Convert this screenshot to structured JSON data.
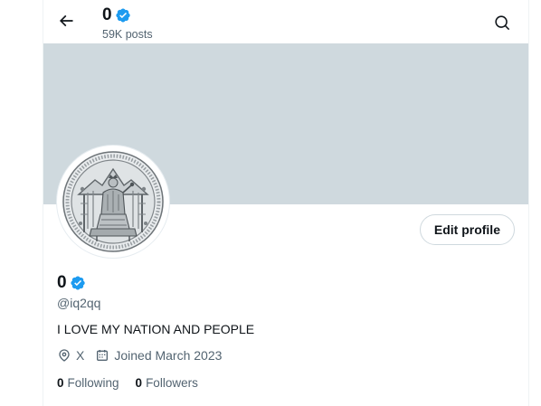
{
  "header": {
    "name": "0",
    "posts_count": "59K posts"
  },
  "profile": {
    "name": "0",
    "handle": "@iq2qq",
    "bio": "I LOVE MY NATION AND PEOPLE",
    "location": "X",
    "joined": "Joined March 2023",
    "edit_label": "Edit profile",
    "following_count": "0",
    "following_label": "Following",
    "followers_count": "0",
    "followers_label": "Followers"
  },
  "icons": {
    "back": "arrow-left-icon",
    "search": "search-icon",
    "verified": "verified-badge-icon",
    "location": "location-pin-icon",
    "calendar": "calendar-icon"
  },
  "colors": {
    "banner": "#cfd9de",
    "verified": "#1d9bf0",
    "secondary_text": "#536471",
    "primary_text": "#0f1419"
  }
}
